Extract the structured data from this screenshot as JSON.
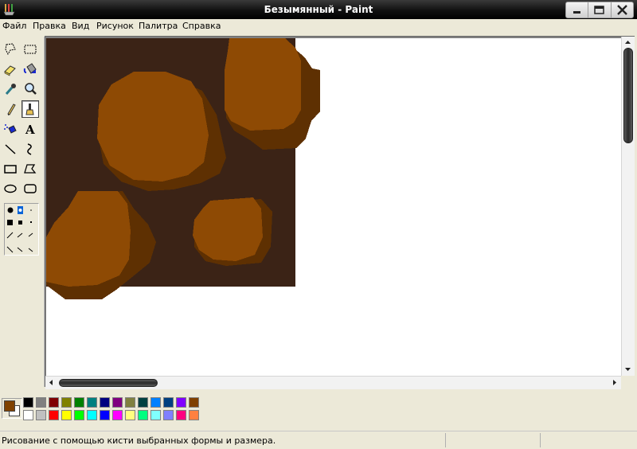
{
  "window": {
    "title": "Безымянный - Paint",
    "icons": {
      "app": "paint-app-icon",
      "minimize": "minimize-icon",
      "maximize": "maximize-icon",
      "close": "close-icon"
    }
  },
  "menu": [
    "Файл",
    "Правка",
    "Вид",
    "Рисунок",
    "Палитра",
    "Справка"
  ],
  "tools": [
    {
      "name": "free-form-select",
      "icon": "free-form-select-icon"
    },
    {
      "name": "rect-select",
      "icon": "rect-select-icon"
    },
    {
      "name": "eraser",
      "icon": "eraser-icon"
    },
    {
      "name": "fill",
      "icon": "fill-bucket-icon"
    },
    {
      "name": "pick-color",
      "icon": "eyedropper-icon"
    },
    {
      "name": "magnifier",
      "icon": "magnifier-icon"
    },
    {
      "name": "pencil",
      "icon": "pencil-icon"
    },
    {
      "name": "brush",
      "icon": "brush-icon",
      "selected": true
    },
    {
      "name": "airbrush",
      "icon": "airbrush-icon"
    },
    {
      "name": "text",
      "icon": "text-icon",
      "label": "A"
    },
    {
      "name": "line",
      "icon": "line-icon"
    },
    {
      "name": "curve",
      "icon": "curve-icon"
    },
    {
      "name": "rectangle",
      "icon": "rectangle-icon"
    },
    {
      "name": "polygon",
      "icon": "polygon-icon"
    },
    {
      "name": "ellipse",
      "icon": "ellipse-icon"
    },
    {
      "name": "rounded-rect",
      "icon": "rounded-rect-icon"
    }
  ],
  "colors": {
    "foreground": "#7f4100",
    "background": "#ffffff",
    "canvas_dark": "#3b2316",
    "canvas_shadow": "#5e3002",
    "canvas_light": "#8e4a04",
    "palette_top": [
      "#000000",
      "#808080",
      "#800000",
      "#808000",
      "#008000",
      "#008080",
      "#000080",
      "#800080",
      "#808040",
      "#004040",
      "#0080ff",
      "#004080",
      "#8000ff",
      "#804000"
    ],
    "palette_bottom": [
      "#ffffff",
      "#c0c0c0",
      "#ff0000",
      "#ffff00",
      "#00ff00",
      "#00ffff",
      "#0000ff",
      "#ff00ff",
      "#ffff80",
      "#00ff80",
      "#80ffff",
      "#8080ff",
      "#ff0080",
      "#ff8040"
    ]
  },
  "status": {
    "text": "Рисование с помощью кисти выбранных формы и размера."
  }
}
